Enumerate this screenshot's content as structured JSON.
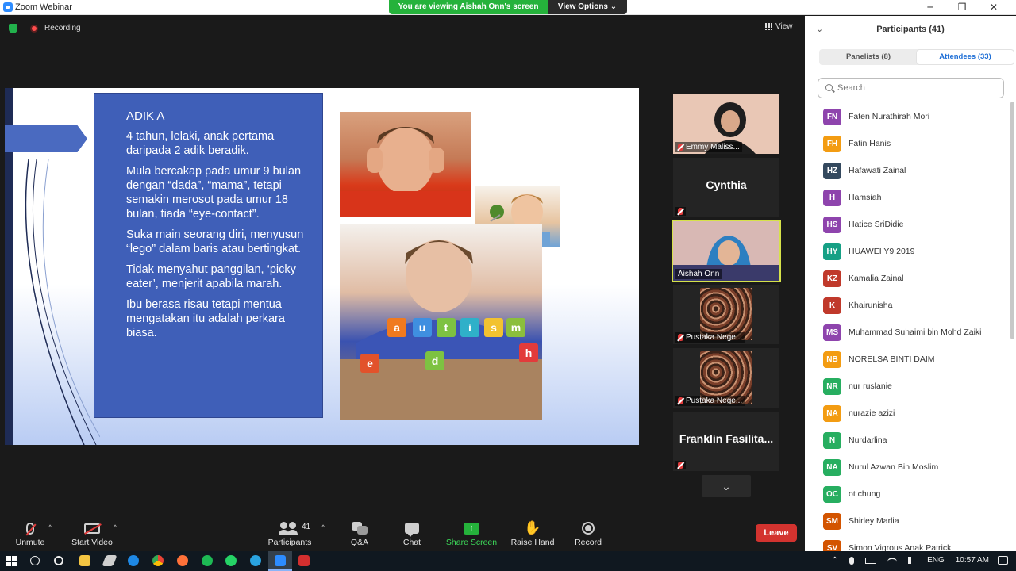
{
  "window": {
    "title": "Zoom Webinar",
    "controls": {
      "minimize": "─",
      "maximize": "❐",
      "close": "✕"
    }
  },
  "banner": {
    "viewing": "You are viewing Aishah Onn's screen",
    "view_options": "View Options ⌄"
  },
  "status": {
    "recording": "Recording",
    "view": "View"
  },
  "slide": {
    "heading": "ADIK A",
    "paragraphs": [
      "4 tahun, lelaki, anak pertama daripada 2 adik beradik.",
      "Mula bercakap pada umur 9 bulan dengan “dada”, “mama”, tetapi semakin merosot pada umur 18 bulan, tiada “eye-contact”.",
      "Suka main seorang diri, menyusun “lego” dalam baris atau bertingkat.",
      "Tidak menyahut panggilan, ‘picky eater’, menjerit apabila marah.",
      "Ibu berasa risau tetapi mentua mengatakan itu adalah perkara biasa."
    ],
    "blocks": [
      {
        "letter": "a",
        "color": "#f07a1f"
      },
      {
        "letter": "u",
        "color": "#3f8fe0"
      },
      {
        "letter": "t",
        "color": "#7dc242"
      },
      {
        "letter": "i",
        "color": "#2fb0c9"
      },
      {
        "letter": "s",
        "color": "#f2c230"
      },
      {
        "letter": "m",
        "color": "#8bbf3c"
      },
      {
        "letter": "e",
        "color": "#e2522b"
      },
      {
        "letter": "d",
        "color": "#7dc242"
      },
      {
        "letter": "h",
        "color": "#e23b3b"
      }
    ]
  },
  "thumbnails": [
    {
      "label": "Emmy Maliss...",
      "type": "video"
    },
    {
      "label": "Cynthia",
      "type": "name"
    },
    {
      "label": "Aishah Onn",
      "type": "video-active"
    },
    {
      "label": "Pustaka Nege...",
      "type": "crowd"
    },
    {
      "label": "Pustaka Nege...",
      "type": "crowd"
    },
    {
      "label": "Franklin Fasilita...",
      "type": "name"
    }
  ],
  "toolbar": {
    "unmute": "Unmute",
    "start_video": "Start Video",
    "participants": "Participants",
    "participants_count": "41",
    "qa": "Q&A",
    "chat": "Chat",
    "share_screen": "Share Screen",
    "raise_hand": "Raise Hand",
    "record": "Record",
    "leave": "Leave"
  },
  "panel": {
    "title": "Participants (41)",
    "tabs": [
      {
        "label": "Panelists (8)",
        "active": false
      },
      {
        "label": "Attendees (33)",
        "active": true
      }
    ],
    "search_placeholder": "Search",
    "participants": [
      {
        "initials": "FN",
        "name": "Faten Nurathirah Mori",
        "color": "#8e44ad"
      },
      {
        "initials": "FH",
        "name": "Fatin Hanis",
        "color": "#f39c12"
      },
      {
        "initials": "HZ",
        "name": "Hafawati Zainal",
        "color": "#34495e"
      },
      {
        "initials": "H",
        "name": "Hamsiah",
        "color": "#8e44ad"
      },
      {
        "initials": "HS",
        "name": "Hatice SriDidie",
        "color": "#8e44ad"
      },
      {
        "initials": "HY",
        "name": "HUAWEI Y9 2019",
        "color": "#16a085"
      },
      {
        "initials": "KZ",
        "name": "Kamalia Zainal",
        "color": "#c0392b"
      },
      {
        "initials": "K",
        "name": "Khairunisha",
        "color": "#c0392b"
      },
      {
        "initials": "MS",
        "name": "Muhammad Suhaimi bin Mohd Zaiki",
        "color": "#8e44ad"
      },
      {
        "initials": "NB",
        "name": "NORELSA BINTI DAIM",
        "color": "#f39c12"
      },
      {
        "initials": "NR",
        "name": "nur ruslanie",
        "color": "#27ae60"
      },
      {
        "initials": "NA",
        "name": "nurazie azizi",
        "color": "#f39c12"
      },
      {
        "initials": "N",
        "name": "Nurdarlina",
        "color": "#27ae60"
      },
      {
        "initials": "NA",
        "name": "Nurul Azwan Bin Moslim",
        "color": "#27ae60"
      },
      {
        "initials": "OC",
        "name": "ot chung",
        "color": "#27ae60"
      },
      {
        "initials": "SM",
        "name": "Shirley Marlia",
        "color": "#d35400"
      },
      {
        "initials": "SV",
        "name": "Simon Vigrous Anak Patrick",
        "color": "#d35400"
      }
    ]
  },
  "taskbar": {
    "language": "ENG",
    "time": "10:57 AM"
  }
}
